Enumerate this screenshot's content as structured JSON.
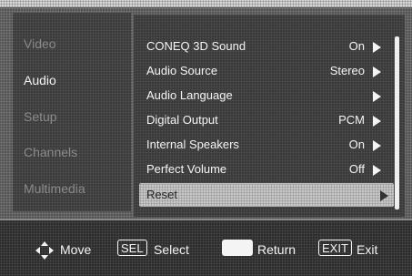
{
  "categories": [
    {
      "label": "Video",
      "active": false
    },
    {
      "label": "Audio",
      "active": true
    },
    {
      "label": "Setup",
      "active": false
    },
    {
      "label": "Channels",
      "active": false
    },
    {
      "label": "Multimedia",
      "active": false
    }
  ],
  "menu": {
    "items": [
      {
        "label": "CONEQ 3D Sound",
        "value": "On"
      },
      {
        "label": "Audio Source",
        "value": "Stereo"
      },
      {
        "label": "Audio Language",
        "value": ""
      },
      {
        "label": "Digital Output",
        "value": "PCM"
      },
      {
        "label": "Internal Speakers",
        "value": "On"
      },
      {
        "label": "Perfect Volume",
        "value": "Off"
      },
      {
        "label": "Reset",
        "value": "",
        "selected": true
      }
    ]
  },
  "footer": {
    "move_label": "Move",
    "sel_key": "SEL",
    "select_label": "Select",
    "return_label": "Return",
    "exit_key": "EXIT",
    "exit_label": "Exit"
  },
  "icons": {
    "move": "four-way-arrow-icon",
    "arrow": "right-triangle-icon"
  }
}
